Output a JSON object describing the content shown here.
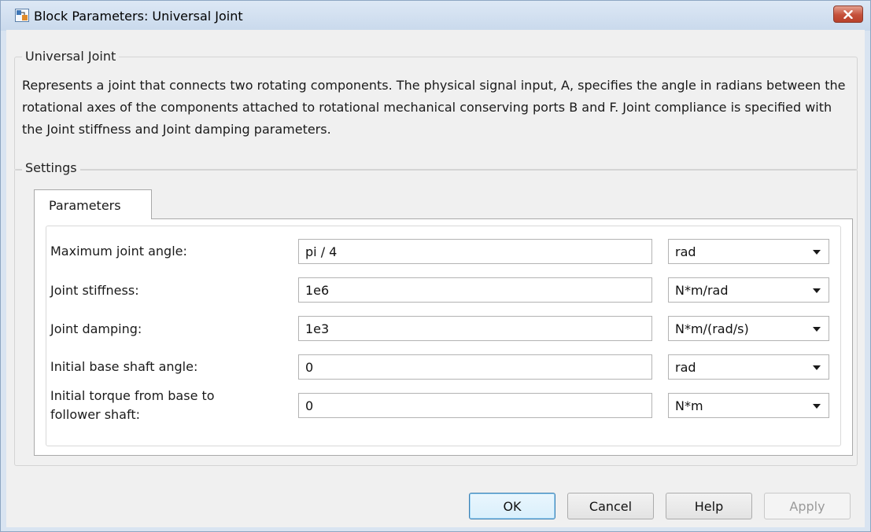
{
  "window": {
    "title": "Block Parameters: Universal Joint",
    "close_icon": "close-icon"
  },
  "block": {
    "name": "Universal Joint",
    "description": "Represents a joint that connects two rotating components. The physical signal input, A, specifies the angle in radians between the rotational axes of the components attached to rotational mechanical conserving ports B and F. Joint compliance is specified with the Joint stiffness and Joint damping parameters."
  },
  "settings": {
    "label": "Settings",
    "tabs": [
      {
        "label": "Parameters",
        "selected": true
      }
    ],
    "parameters": [
      {
        "label": "Maximum joint angle:",
        "value": "pi / 4",
        "unit": "rad"
      },
      {
        "label": "Joint stiffness:",
        "value": "1e6",
        "unit": "N*m/rad"
      },
      {
        "label": "Joint damping:",
        "value": "1e3",
        "unit": "N*m/(rad/s)"
      },
      {
        "label": "Initial base shaft angle:",
        "value": "0",
        "unit": "rad"
      },
      {
        "label_line1": "Initial torque from base to",
        "label_line2": "follower shaft:",
        "value": "0",
        "unit": "N*m"
      }
    ]
  },
  "buttons": {
    "ok": "OK",
    "cancel": "Cancel",
    "help": "Help",
    "apply": "Apply"
  },
  "colors": {
    "title_bar": "#c9d9ec",
    "close_button": "#c5503a",
    "dialog_background": "#f0f0f0",
    "ok_button_border": "#3c7fb1"
  }
}
